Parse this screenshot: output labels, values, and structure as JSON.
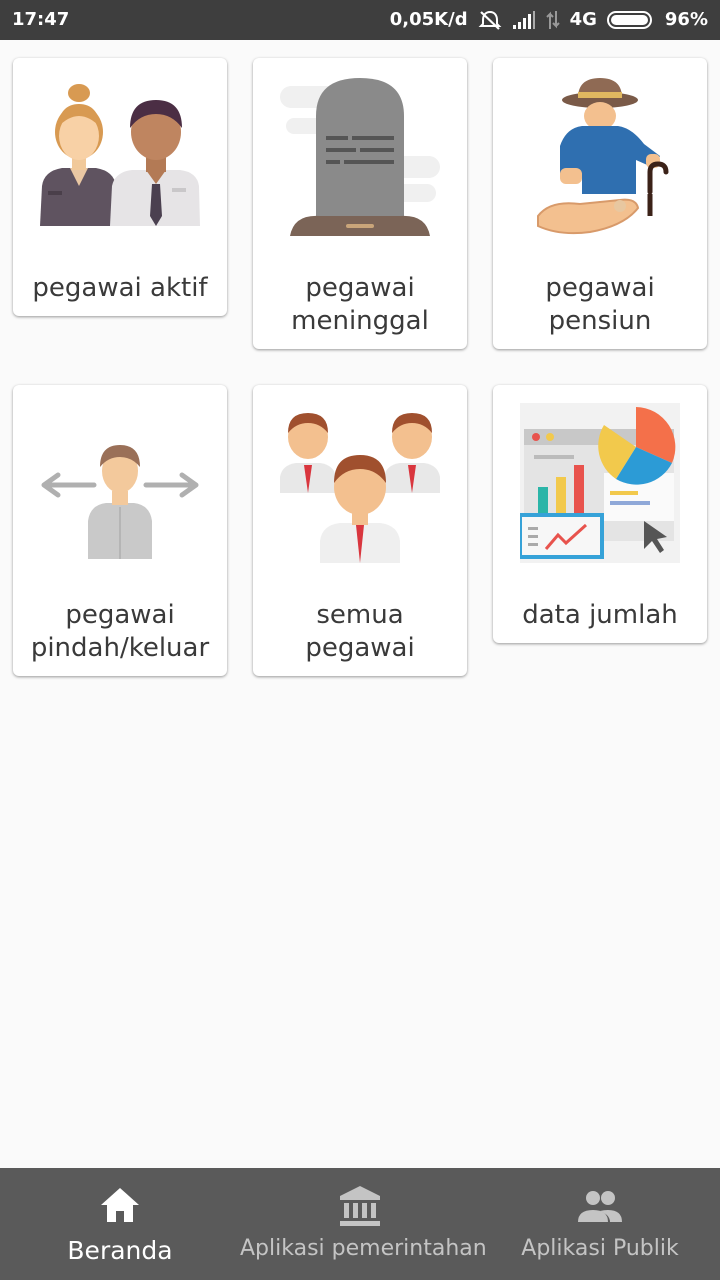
{
  "status_bar": {
    "time": "17:47",
    "network_speed": "0,05K/d",
    "network_type": "4G",
    "battery": "96%",
    "icons": [
      "alarm-off-icon",
      "signal-icon",
      "data-arrows-icon",
      "battery-icon"
    ]
  },
  "menu": {
    "tiles": [
      {
        "label": "pegawai aktif",
        "icon": "active-employees-icon"
      },
      {
        "label": "pegawai\nmeninggal",
        "icon": "tombstone-icon"
      },
      {
        "label": "pegawai\npensiun",
        "icon": "retiree-icon"
      },
      {
        "label": "pegawai\npindah/keluar",
        "icon": "transfer-employee-icon"
      },
      {
        "label": "semua\npegawai",
        "icon": "all-employees-icon"
      },
      {
        "label": "data jumlah",
        "icon": "data-dashboard-icon"
      }
    ]
  },
  "bottom_nav": {
    "items": [
      {
        "label": "Beranda",
        "icon": "home-icon",
        "active": true
      },
      {
        "label": "Aplikasi pemerintahan",
        "icon": "government-building-icon",
        "active": false
      },
      {
        "label": "Aplikasi Publik",
        "icon": "people-icon",
        "active": false
      }
    ]
  },
  "colors": {
    "status_bar": "#3e3e3e",
    "background": "#fafafa",
    "bottom_nav": "#5a5a5a",
    "nav_active": "#ffffff",
    "nav_inactive": "#c4c4c4"
  }
}
